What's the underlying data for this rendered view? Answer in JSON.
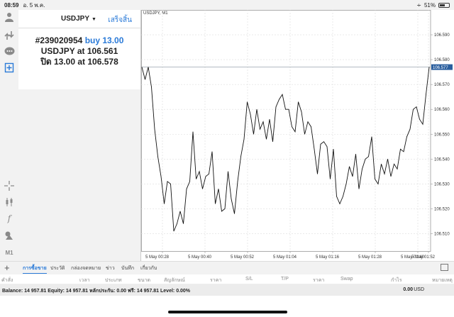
{
  "status_bar": {
    "time": "08:59",
    "date": "อ. 5 พ.ค.",
    "battery": "51%",
    "battery_fraction": 0.51
  },
  "panel": {
    "symbol": "USDJPY",
    "done_label": "เสร็จสิ้น",
    "order_line": "#239020954",
    "order_action": "buy 13.00",
    "open_prefix": "USDJPY at",
    "open_price": "106.561",
    "close_prefix": "ปิด 13.00 at",
    "close_price": "106.578"
  },
  "chart": {
    "title": "USDJPY, M1",
    "current_price_label": "106.577"
  },
  "chart_data": {
    "type": "line",
    "title": "USDJPY, M1",
    "xlabel": "",
    "ylabel": "",
    "ylim": [
      106.503,
      106.6
    ],
    "yticks": [
      "106.590",
      "106.580",
      "106.570",
      "106.560",
      "106.550",
      "106.540",
      "106.530",
      "106.520",
      "106.510"
    ],
    "xticks": [
      "5 May 00:28",
      "5 May 00:40",
      "5 May 00:52",
      "5 May 01:04",
      "5 May 01:16",
      "5 May 01:28",
      "5 May 01:40",
      "5 May 01:52"
    ],
    "current_price": 106.577,
    "series": [
      {
        "values": [
          106.577,
          106.572,
          106.577,
          106.569,
          106.552,
          106.541,
          106.533,
          106.522,
          106.531,
          106.53,
          106.511,
          106.514,
          106.519,
          106.514,
          106.528,
          106.531,
          106.551,
          106.532,
          106.535,
          106.528,
          106.533,
          106.534,
          106.543,
          106.522,
          106.528,
          106.519,
          106.52,
          106.535,
          106.524,
          106.518,
          106.531,
          106.541,
          106.548,
          106.563,
          106.558,
          106.55,
          106.56,
          106.552,
          106.555,
          106.548,
          106.556,
          106.547,
          106.561,
          106.564,
          106.566,
          106.56,
          106.56,
          106.553,
          106.551,
          106.563,
          106.559,
          106.55,
          106.555,
          106.553,
          106.544,
          106.534,
          106.546,
          106.547,
          106.545,
          106.532,
          106.544,
          106.525,
          106.522,
          106.525,
          106.53,
          106.537,
          106.533,
          106.542,
          106.528,
          106.536,
          106.54,
          106.541,
          106.549,
          106.532,
          106.53,
          106.538,
          106.534,
          106.54,
          106.533,
          106.538,
          106.536,
          106.544,
          106.543,
          106.549,
          106.552,
          106.56,
          106.561,
          106.556,
          106.554,
          106.566,
          106.577
        ]
      }
    ]
  },
  "tabs": [
    {
      "label": "การซื้อขาย",
      "active": true
    },
    {
      "label": "ประวัติ"
    },
    {
      "label": "กล่องจดหมาย"
    },
    {
      "label": "ข่าว"
    },
    {
      "label": "บันทึก"
    },
    {
      "label": "เกี่ยวกับ"
    }
  ],
  "columns": [
    "คำสั่ง",
    "เวลา",
    "ประเภท",
    "ขนาด",
    "สัญลักษณ์",
    "ราคา",
    "S/L",
    "T/P",
    "ราคา",
    "Swap",
    "กำไร",
    "หมายเหตุ"
  ],
  "balance": {
    "text": "Balance: 14 957.81  Equity: 14 957.81  หลักประกัน: 0.00  ฟรี: 14 957.81  Level: 0.00%",
    "profit": "0.00",
    "currency": "USD"
  },
  "icons": {
    "left_toolbar": [
      "person-icon",
      "trade-arrows-icon",
      "chat-icon",
      "new-order-icon",
      "crosshair-icon",
      "candles-icon",
      "function-icon",
      "objects-icon",
      "timeframe-icon"
    ],
    "timeframe_label": "M1"
  }
}
